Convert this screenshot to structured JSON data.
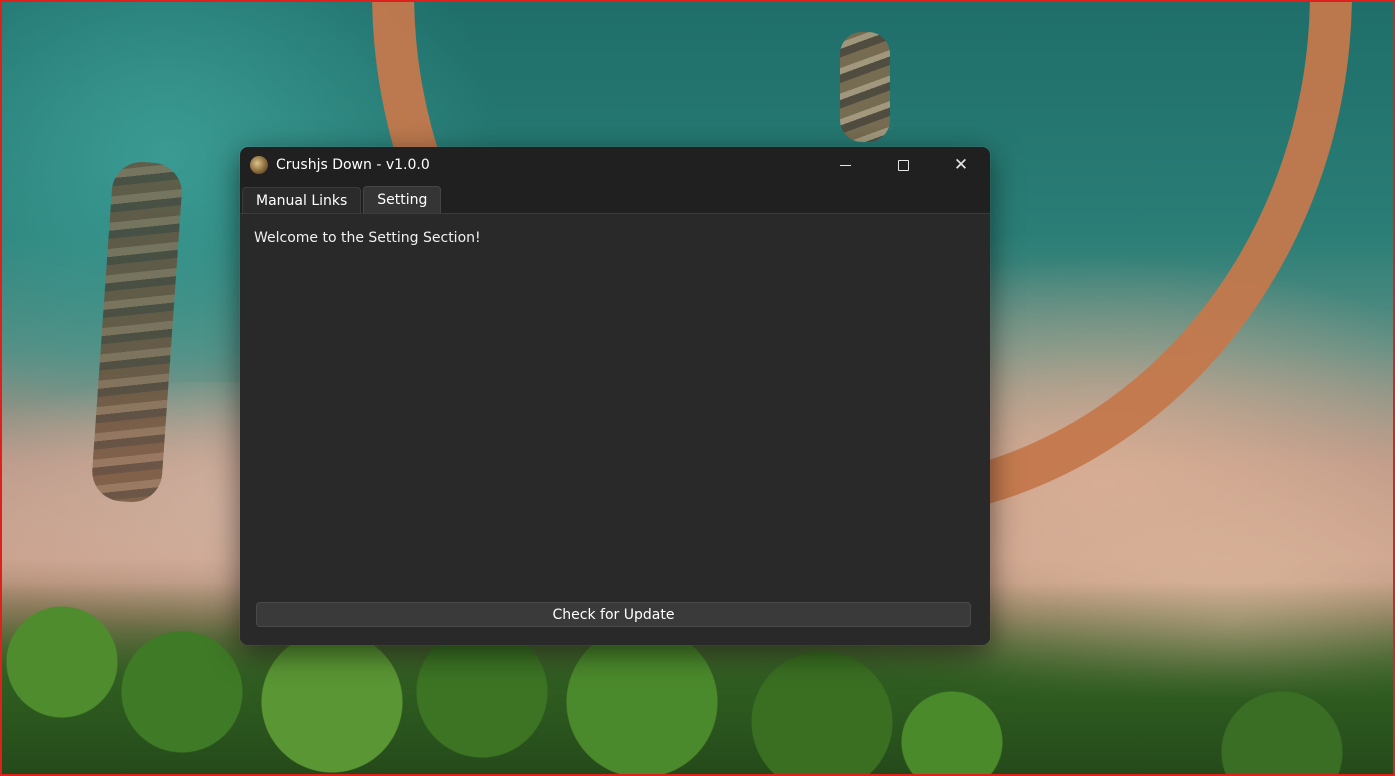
{
  "window": {
    "title": "Crushjs Down - v1.0.0",
    "controls": {
      "minimize_icon": "minimize-icon",
      "maximize_icon": "maximize-icon",
      "close_icon": "close-icon"
    }
  },
  "tabs": [
    {
      "label": "Manual Links",
      "active": false
    },
    {
      "label": "Setting",
      "active": true
    }
  ],
  "setting": {
    "welcome_text": "Welcome to the Setting Section!",
    "update_button_label": "Check for Update"
  },
  "colors": {
    "window_bg": "#202020",
    "content_bg": "#292929",
    "button_bg": "#3a3a3a",
    "desktop_border": "#e0201c"
  }
}
